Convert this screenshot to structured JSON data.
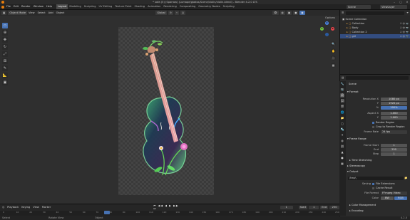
{
  "window": {
    "title": "* sofa (5) (Sparrow) (Lumape/glados/Scene/violin/violin.blend) - Blender 4.2.0 LTS",
    "minimize": "–",
    "maximize": "▢",
    "close": "✕"
  },
  "topbar": {
    "menus": [
      "File",
      "Edit",
      "Render",
      "Window",
      "Help"
    ],
    "workspaces": [
      "Layout",
      "Modeling",
      "Sculpting",
      "UV Editing",
      "Texture Paint",
      "Shading",
      "Animation",
      "Rendering",
      "Compositing",
      "Geometry Nodes",
      "Scripting"
    ],
    "active_workspace": "Layout",
    "scene_label": "Scene",
    "view_layer_label": "ViewLayer"
  },
  "viewport_header": {
    "mode": "Object Mode",
    "menus": [
      "View",
      "Select",
      "Add",
      "Object"
    ],
    "orientation": "Global",
    "options": "Options"
  },
  "toolbar": {
    "tools": [
      "select",
      "cursor",
      "move",
      "rotate",
      "scale",
      "transform",
      "annotate",
      "measure",
      "add-cube"
    ]
  },
  "gizmo": {
    "x": "X",
    "y": "Y",
    "z": "Z",
    "colors": {
      "x": "#e8464c",
      "y": "#72c242",
      "z": "#4c86e8"
    }
  },
  "outliner": {
    "search_placeholder": "",
    "rows": [
      {
        "label": "Scene Collection",
        "indent": 0,
        "selected": false
      },
      {
        "label": "Collection",
        "indent": 1,
        "selected": false
      },
      {
        "label": "Body",
        "indent": 1,
        "selected": false
      },
      {
        "label": "Collection 2",
        "indent": 1,
        "selected": false
      },
      {
        "label": "girl",
        "indent": 1,
        "selected": true
      }
    ]
  },
  "properties": {
    "breadcrumb": "Scene",
    "format_title": "Format",
    "fields": [
      {
        "label": "Resolution X",
        "value": "1080 px",
        "highlight": false
      },
      {
        "label": "Y",
        "value": "1920 px",
        "highlight": false
      },
      {
        "label": "%",
        "value": "100%",
        "highlight": true
      },
      {
        "label": "Aspect X",
        "value": "1.000",
        "highlight": false
      },
      {
        "label": "Y",
        "value": "1.000",
        "highlight": false
      }
    ],
    "render_region": "Render Region",
    "crop_region": "Crop to Render Region",
    "frame_rate_label": "Frame Rate",
    "frame_rate_value": "24 fps",
    "frame_range_title": "Frame Range",
    "frame_fields": [
      {
        "label": "Frame Start",
        "value": "1"
      },
      {
        "label": "End",
        "value": "250"
      },
      {
        "label": "Step",
        "value": "1"
      }
    ],
    "time_stretching": "Time Stretching",
    "stereoscopy": "Stereoscopy",
    "output_title": "Output",
    "output_path": "/tmp\\",
    "saving_label": "Saving",
    "file_extensions": "File Extensions",
    "cache_result": "Cache Result",
    "file_format_label": "File Format",
    "file_format_value": "FFmpeg Video",
    "color_label": "Color",
    "color_bw": "BW",
    "color_rgb": "RGB",
    "color_management": "Color Management",
    "encoding": "Encoding"
  },
  "timeline": {
    "menus": [
      "Playback",
      "Keying",
      "View",
      "Marker"
    ],
    "current_frame": "1",
    "start_label": "Start",
    "start_value": "1",
    "end_label": "End",
    "end_value": "250",
    "ticks": [
      "0",
      "10",
      "20",
      "30",
      "40",
      "50",
      "60",
      "70",
      "80",
      "90",
      "100",
      "110",
      "120",
      "130",
      "140",
      "150",
      "160",
      "170",
      "180",
      "190",
      "200",
      "210",
      "220",
      "230",
      "240",
      "250"
    ]
  },
  "statusbar": {
    "left": "Select",
    "middle": "Rotate View",
    "right": "Object",
    "version": "4.2.0"
  }
}
